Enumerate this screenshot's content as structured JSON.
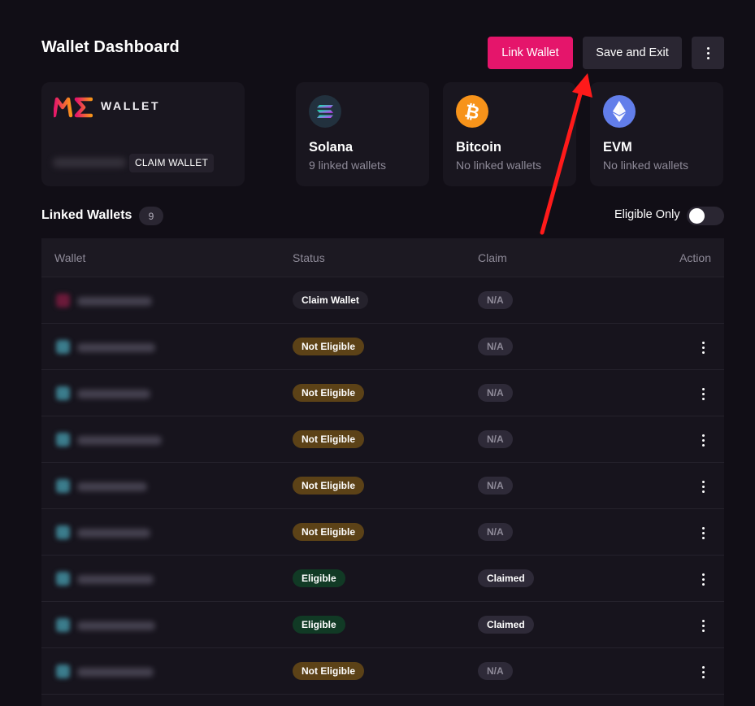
{
  "header": {
    "title": "Wallet Dashboard",
    "link_wallet_label": "Link Wallet",
    "save_exit_label": "Save and Exit",
    "more_icon": "kebab-icon"
  },
  "me_card": {
    "wordmark": "WALLET",
    "claim_tag": "CLAIM WALLET",
    "logo_colors": [
      "#e5156b",
      "#f7931a"
    ]
  },
  "chains": [
    {
      "name": "Solana",
      "sub": "9 linked wallets",
      "icon": "solana-icon",
      "color": "#22313e"
    },
    {
      "name": "Bitcoin",
      "sub": "No linked wallets",
      "icon": "bitcoin-icon",
      "color": "#f7931a"
    },
    {
      "name": "EVM",
      "sub": "No linked wallets",
      "icon": "ethereum-icon",
      "color": "#627eea"
    }
  ],
  "linked": {
    "title": "Linked Wallets",
    "count": "9",
    "toggle_label": "Eligible Only",
    "toggle_on": false
  },
  "table": {
    "columns": [
      "Wallet",
      "Status",
      "Claim",
      "Action"
    ],
    "rows": [
      {
        "status": "Claim Wallet",
        "claim": "N/A",
        "has_action": false
      },
      {
        "status": "Not Eligible",
        "claim": "N/A",
        "has_action": true
      },
      {
        "status": "Not Eligible",
        "claim": "N/A",
        "has_action": true
      },
      {
        "status": "Not Eligible",
        "claim": "N/A",
        "has_action": true
      },
      {
        "status": "Not Eligible",
        "claim": "N/A",
        "has_action": true
      },
      {
        "status": "Not Eligible",
        "claim": "N/A",
        "has_action": true
      },
      {
        "status": "Eligible",
        "claim": "Claimed",
        "has_action": true
      },
      {
        "status": "Eligible",
        "claim": "Claimed",
        "has_action": true
      },
      {
        "status": "Not Eligible",
        "claim": "N/A",
        "has_action": true
      }
    ]
  },
  "colors": {
    "accent": "#e5156b",
    "background": "#110e16",
    "not_eligible": "#5c4217",
    "eligible": "#113a25",
    "annotation_arrow": "#ff1a1a"
  }
}
